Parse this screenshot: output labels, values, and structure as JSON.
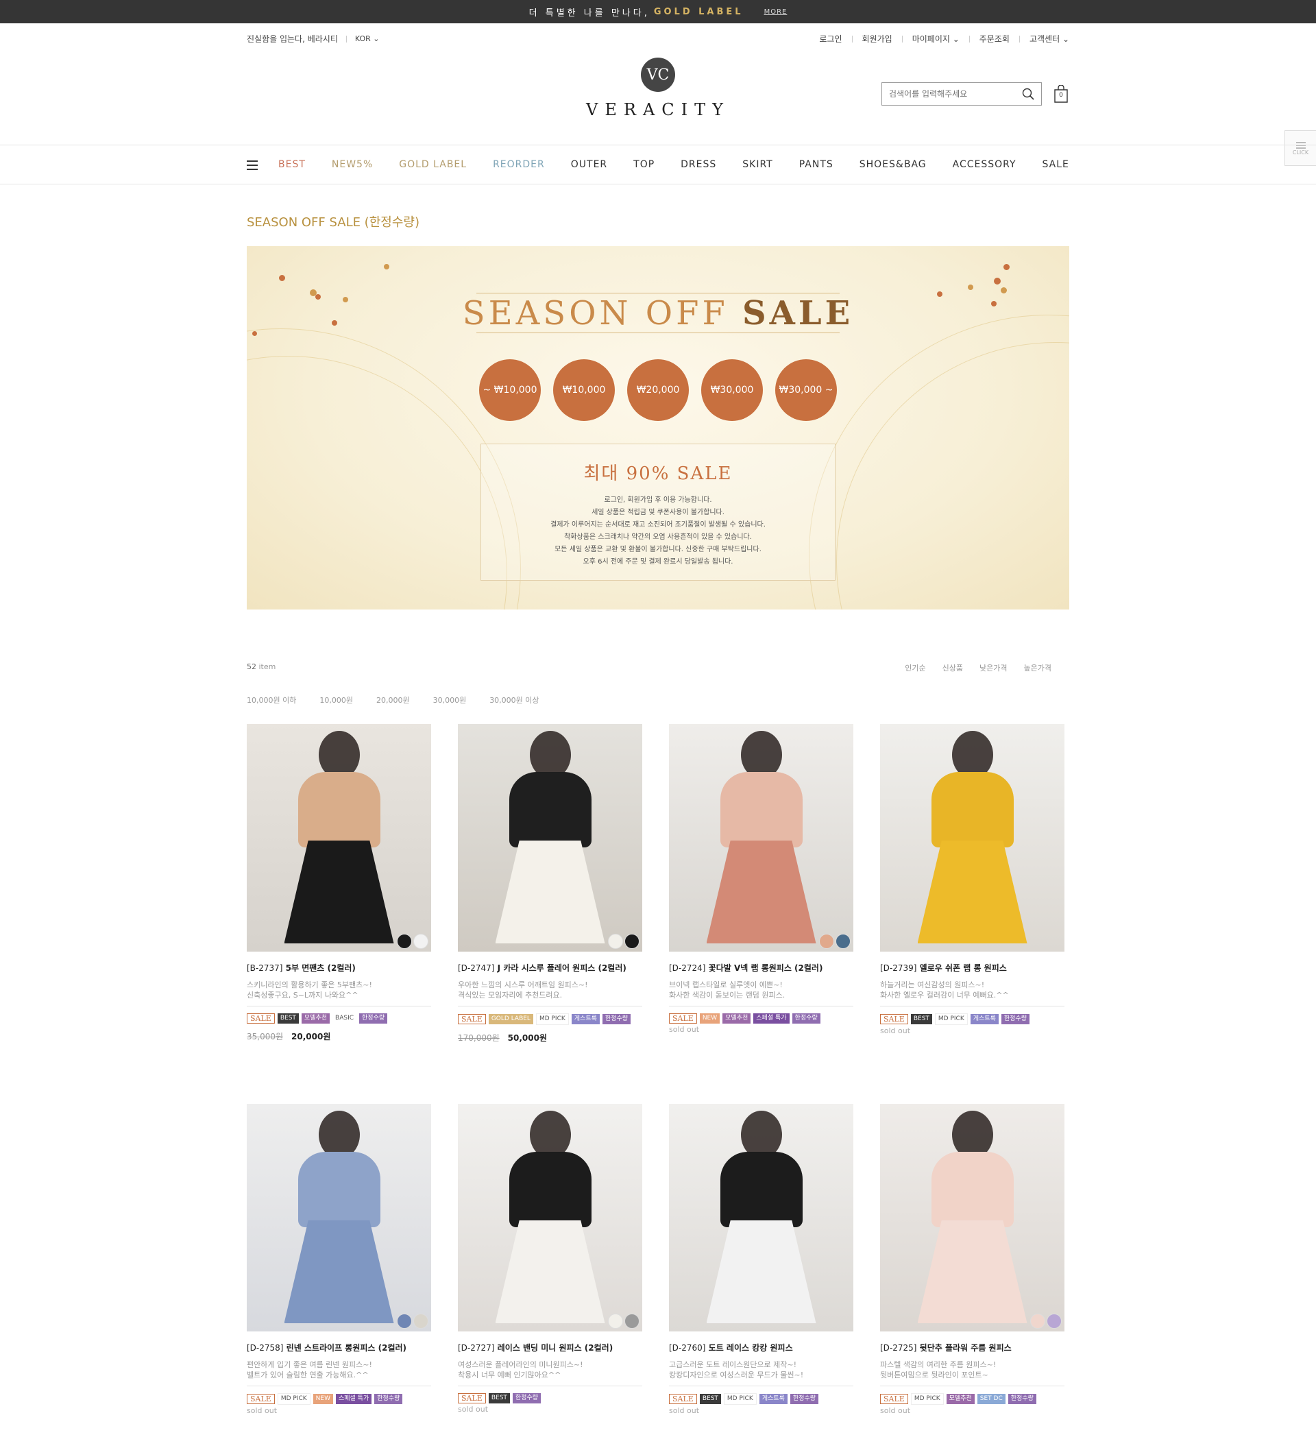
{
  "topbar": {
    "text": "더 특별한 나를 만나다,",
    "highlight": "GOLD LABEL",
    "more": "MORE"
  },
  "util": {
    "slogan": "진실함을 입는다, 베라시티",
    "lang": "KOR ⌄",
    "login": "로그인",
    "join": "회원가입",
    "mypage": "마이페이지 ⌄",
    "order": "주문조회",
    "cs": "고객센터 ⌄"
  },
  "logo": {
    "mark": "VC",
    "word": "VERACITY"
  },
  "search": {
    "placeholder": "검색어를 입력해주세요"
  },
  "cart": {
    "count": "0"
  },
  "side_button": "CLICK",
  "nav": [
    "BEST",
    "NEW5%",
    "GOLD LABEL",
    "REORDER",
    "OUTER",
    "TOP",
    "DRESS",
    "SKIRT",
    "PANTS",
    "SHOES&BAG",
    "ACCESSORY",
    "SALE"
  ],
  "category_title": "SEASON OFF SALE (한정수량)",
  "banner": {
    "head_a": "SEASON OFF ",
    "head_b": "SALE",
    "circles": [
      "~ ₩10,000",
      "₩10,000",
      "₩20,000",
      "₩30,000",
      "₩30,000 ~"
    ],
    "big": "최대 90% SALE",
    "notes": [
      "로그인, 회원가입 후 이용 가능합니다.",
      "세일 상품은 적립금 및 쿠폰사용이 불가합니다.",
      "결제가 이루어지는 순서대로 재고 소진되어 조기품절이 발생될 수 있습니다.",
      "착화상품은 스크래치나 약간의 오염 사용흔적이 있을 수 있습니다.",
      "모든 세일 상품은 교환 및 환불이 불가합니다. 신중한 구매 부탁드립니다.",
      "오후 6시 전에 주문 및 결제 완료시 당일발송 됩니다."
    ]
  },
  "list": {
    "count": "52",
    "count_label": " item"
  },
  "sort": [
    "인기순",
    "신상품",
    "낮은가격",
    "높은가격"
  ],
  "price_filter": [
    "10,000원 이하",
    "10,000원",
    "20,000원",
    "30,000원",
    "30,000원 이상"
  ],
  "products": [
    {
      "code": "[B-2737]",
      "name": "5부 면팬츠 (2컬러)",
      "desc1": "스키니라인의 활용하기 좋은 5부팬츠~!",
      "desc2": "신축성좋구요, S~L까지 나와요^^",
      "tags": [
        "BEST",
        "모델추천",
        "BASIC",
        "한정수량"
      ],
      "tagtypes": [
        "best",
        "model",
        "basic",
        "limited"
      ],
      "old_price": "35,000원",
      "price": "20,000원",
      "soldout": ""
    },
    {
      "code": "[D-2747]",
      "name": "J 카라 시스루 플레어 원피스 (2컬러)",
      "desc1": "우아한 느낌의 시스루 어깨트임 원피스~!",
      "desc2": "격식있는 모임자리에 추천드려요.",
      "tags": [
        "GOLD LABEL",
        "MD PICK",
        "게스트룩",
        "한정수량"
      ],
      "tagtypes": [
        "goldlabel",
        "mdpick",
        "guest",
        "limited"
      ],
      "old_price": "170,000원",
      "price": "50,000원",
      "soldout": ""
    },
    {
      "code": "[D-2724]",
      "name": "꽃다발 V넥 랩 롱원피스 (2컬러)",
      "desc1": "브이넥 랩스타일로 실루엣이 예쁜~!",
      "desc2": "화사한 색감이 돋보이는 랜덤 원피스.",
      "tags": [
        "NEW",
        "모델추천",
        "스페셜 특가",
        "한정수량"
      ],
      "tagtypes": [
        "new",
        "model",
        "special",
        "limited"
      ],
      "old_price": "",
      "price": "",
      "soldout": "sold out"
    },
    {
      "code": "[D-2739]",
      "name": "옐로우 쉬폰 랩 롱 원피스",
      "desc1": "하늘거리는 여신감성의 원피스~!",
      "desc2": "화사한 옐로우 컬러감이 너무 예뻐요.^^",
      "tags": [
        "BEST",
        "MD PICK",
        "게스트룩",
        "한정수량"
      ],
      "tagtypes": [
        "best",
        "mdpick",
        "guest",
        "limited"
      ],
      "old_price": "",
      "price": "",
      "soldout": "sold out"
    },
    {
      "code": "[D-2758]",
      "name": "린넨 스트라이프 롱원피스 (2컬러)",
      "desc1": "편안하게 입기 좋은 여름 린넨 원피스~!",
      "desc2": "벨트가 있어 슬림한 연출 가능해요.^^",
      "tags": [
        "MD PICK",
        "NEW",
        "스페셜 특가",
        "한정수량"
      ],
      "tagtypes": [
        "mdpick",
        "new",
        "special",
        "limited"
      ],
      "old_price": "",
      "price": "",
      "soldout": "sold out"
    },
    {
      "code": "[D-2727]",
      "name": "레이스 밴딩 미니 원피스 (2컬러)",
      "desc1": "여성스러운 플레어라인의 미니원피스~!",
      "desc2": "착용시 너무 예뻐 인기많아요^^",
      "tags": [
        "BEST",
        "한정수량"
      ],
      "tagtypes": [
        "best",
        "limited"
      ],
      "old_price": "",
      "price": "",
      "soldout": "sold out"
    },
    {
      "code": "[D-2760]",
      "name": "도트 레이스 캉캉 원피스",
      "desc1": "고급스러운 도트 레이스원단으로 제작~!",
      "desc2": "캉캉디자인으로 여성스러운 무드가 물씬~!",
      "tags": [
        "BEST",
        "MD PICK",
        "게스트룩",
        "한정수량"
      ],
      "tagtypes": [
        "best",
        "mdpick",
        "guest",
        "limited"
      ],
      "old_price": "",
      "price": "",
      "soldout": "sold out"
    },
    {
      "code": "[D-2725]",
      "name": "뒷단추 플라워 주름 원피스",
      "desc1": "파스텔 색감의 여리한 주름 원피스~!",
      "desc2": "뒷버튼여밈으로 뒷라인이 포인트~",
      "tags": [
        "MD PICK",
        "모델추천",
        "SET DC",
        "한정수량"
      ],
      "tagtypes": [
        "mdpick",
        "model",
        "setdc",
        "limited"
      ],
      "old_price": "",
      "price": "",
      "soldout": "sold out"
    }
  ],
  "sale_tag": "SALE",
  "colors": {
    "accent": "#c8703f",
    "gold": "#b8913f",
    "topbar": "#353535"
  },
  "icons": {
    "search": "search-icon",
    "cart": "shopping-bag-icon",
    "menu": "hamburger-icon"
  }
}
